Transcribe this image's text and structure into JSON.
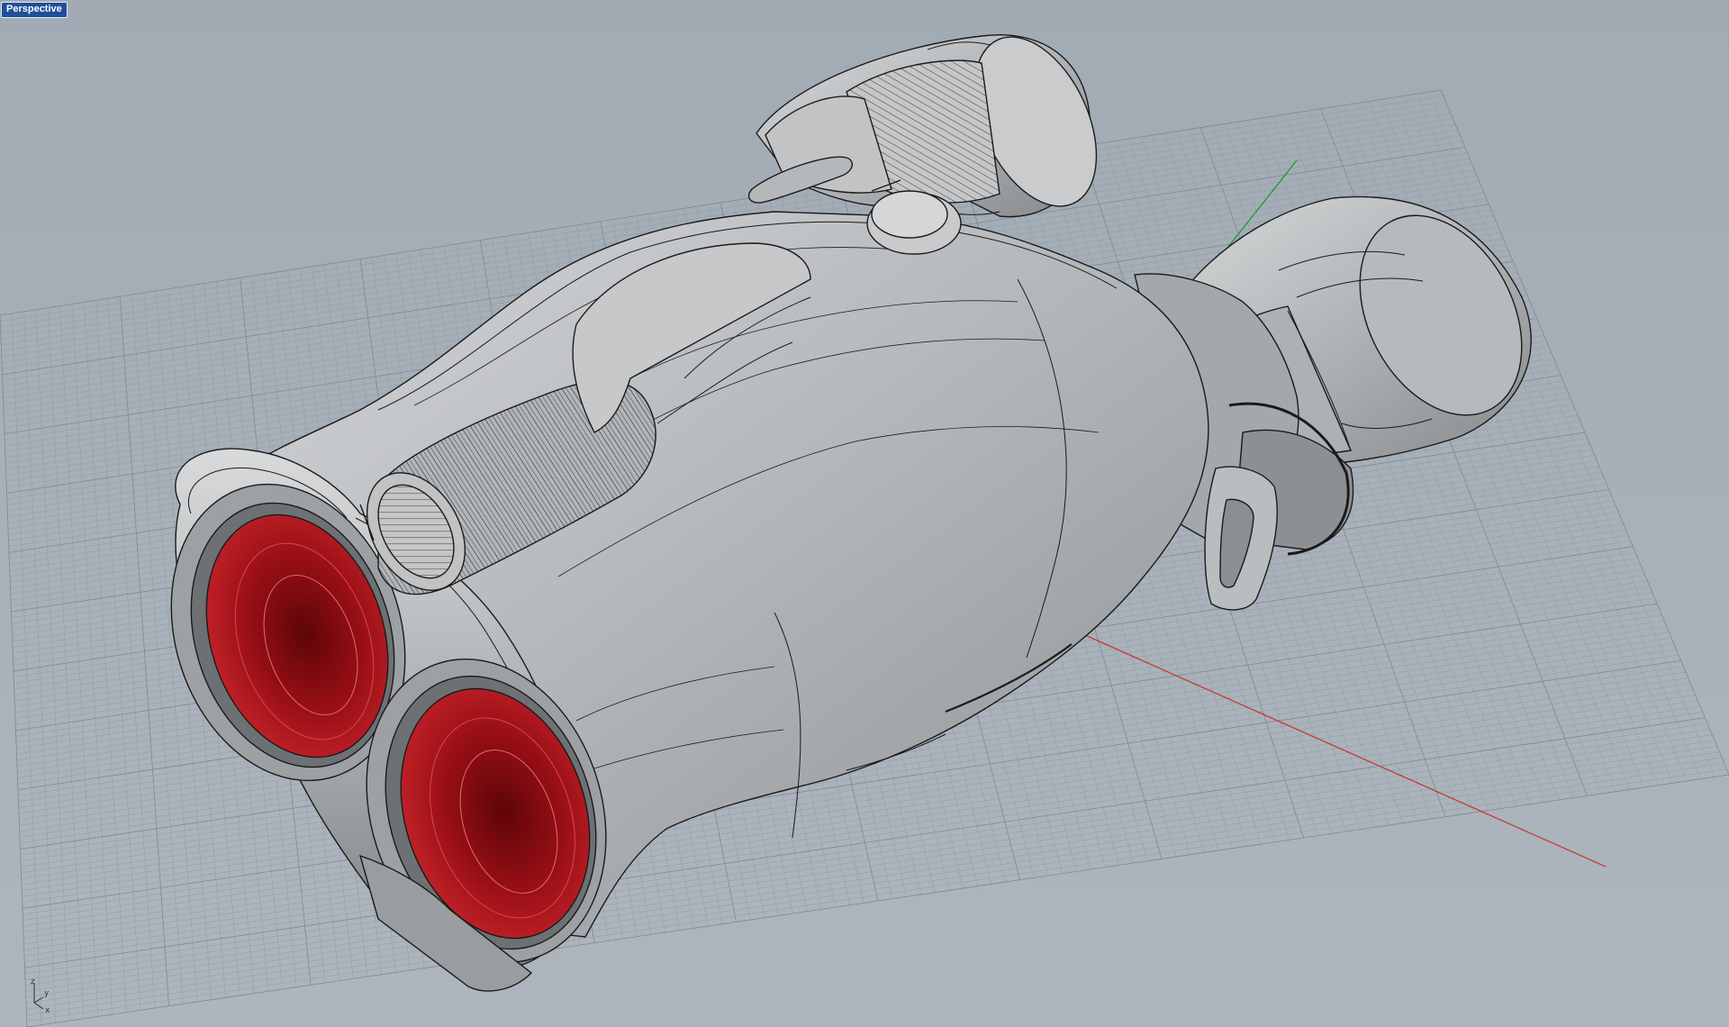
{
  "viewport": {
    "title": "Perspective",
    "background_color": "#a4adb6",
    "grid_color": "#8f99a3",
    "grid_major_color": "#7f8893"
  },
  "axes": {
    "x_axis_color": "#c63a32",
    "y_axis_color": "#1c9a31"
  },
  "widget": {
    "z_label": "z",
    "y_label": "y",
    "x_label": "x"
  },
  "model": {
    "name": "binoculars",
    "body_color": "#b9bcbf",
    "lens_color": "#a0141a",
    "wire_color": "#1a1a1a"
  }
}
